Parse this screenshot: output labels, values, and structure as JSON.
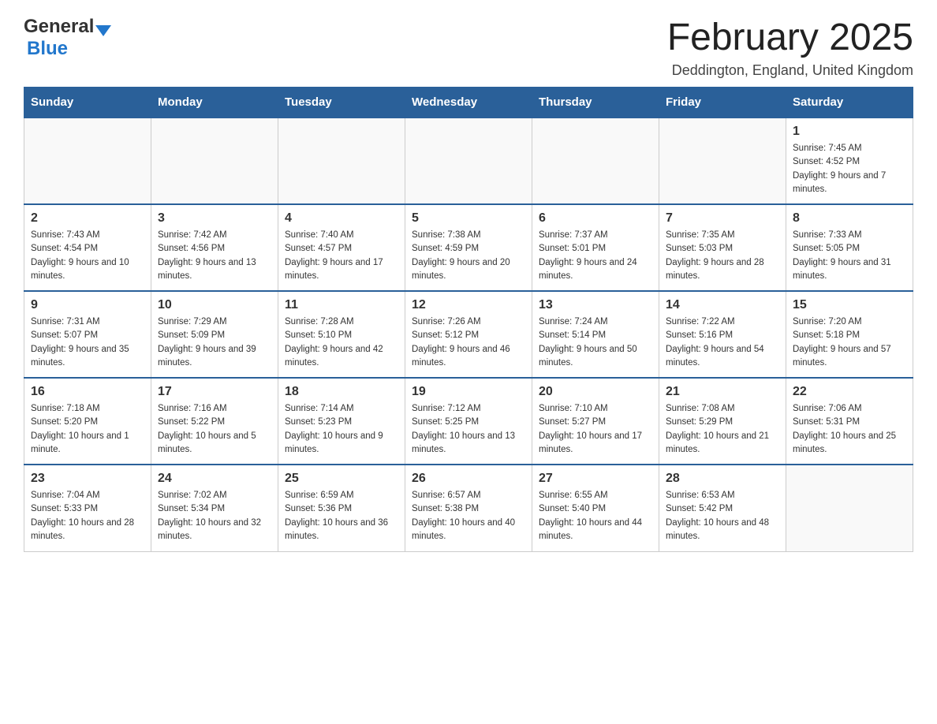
{
  "header": {
    "logo_general": "General",
    "logo_blue": "Blue",
    "month_title": "February 2025",
    "location": "Deddington, England, United Kingdom"
  },
  "days_of_week": [
    "Sunday",
    "Monday",
    "Tuesday",
    "Wednesday",
    "Thursday",
    "Friday",
    "Saturday"
  ],
  "weeks": [
    [
      {
        "day": "",
        "sunrise": "",
        "sunset": "",
        "daylight": ""
      },
      {
        "day": "",
        "sunrise": "",
        "sunset": "",
        "daylight": ""
      },
      {
        "day": "",
        "sunrise": "",
        "sunset": "",
        "daylight": ""
      },
      {
        "day": "",
        "sunrise": "",
        "sunset": "",
        "daylight": ""
      },
      {
        "day": "",
        "sunrise": "",
        "sunset": "",
        "daylight": ""
      },
      {
        "day": "",
        "sunrise": "",
        "sunset": "",
        "daylight": ""
      },
      {
        "day": "1",
        "sunrise": "Sunrise: 7:45 AM",
        "sunset": "Sunset: 4:52 PM",
        "daylight": "Daylight: 9 hours and 7 minutes."
      }
    ],
    [
      {
        "day": "2",
        "sunrise": "Sunrise: 7:43 AM",
        "sunset": "Sunset: 4:54 PM",
        "daylight": "Daylight: 9 hours and 10 minutes."
      },
      {
        "day": "3",
        "sunrise": "Sunrise: 7:42 AM",
        "sunset": "Sunset: 4:56 PM",
        "daylight": "Daylight: 9 hours and 13 minutes."
      },
      {
        "day": "4",
        "sunrise": "Sunrise: 7:40 AM",
        "sunset": "Sunset: 4:57 PM",
        "daylight": "Daylight: 9 hours and 17 minutes."
      },
      {
        "day": "5",
        "sunrise": "Sunrise: 7:38 AM",
        "sunset": "Sunset: 4:59 PM",
        "daylight": "Daylight: 9 hours and 20 minutes."
      },
      {
        "day": "6",
        "sunrise": "Sunrise: 7:37 AM",
        "sunset": "Sunset: 5:01 PM",
        "daylight": "Daylight: 9 hours and 24 minutes."
      },
      {
        "day": "7",
        "sunrise": "Sunrise: 7:35 AM",
        "sunset": "Sunset: 5:03 PM",
        "daylight": "Daylight: 9 hours and 28 minutes."
      },
      {
        "day": "8",
        "sunrise": "Sunrise: 7:33 AM",
        "sunset": "Sunset: 5:05 PM",
        "daylight": "Daylight: 9 hours and 31 minutes."
      }
    ],
    [
      {
        "day": "9",
        "sunrise": "Sunrise: 7:31 AM",
        "sunset": "Sunset: 5:07 PM",
        "daylight": "Daylight: 9 hours and 35 minutes."
      },
      {
        "day": "10",
        "sunrise": "Sunrise: 7:29 AM",
        "sunset": "Sunset: 5:09 PM",
        "daylight": "Daylight: 9 hours and 39 minutes."
      },
      {
        "day": "11",
        "sunrise": "Sunrise: 7:28 AM",
        "sunset": "Sunset: 5:10 PM",
        "daylight": "Daylight: 9 hours and 42 minutes."
      },
      {
        "day": "12",
        "sunrise": "Sunrise: 7:26 AM",
        "sunset": "Sunset: 5:12 PM",
        "daylight": "Daylight: 9 hours and 46 minutes."
      },
      {
        "day": "13",
        "sunrise": "Sunrise: 7:24 AM",
        "sunset": "Sunset: 5:14 PM",
        "daylight": "Daylight: 9 hours and 50 minutes."
      },
      {
        "day": "14",
        "sunrise": "Sunrise: 7:22 AM",
        "sunset": "Sunset: 5:16 PM",
        "daylight": "Daylight: 9 hours and 54 minutes."
      },
      {
        "day": "15",
        "sunrise": "Sunrise: 7:20 AM",
        "sunset": "Sunset: 5:18 PM",
        "daylight": "Daylight: 9 hours and 57 minutes."
      }
    ],
    [
      {
        "day": "16",
        "sunrise": "Sunrise: 7:18 AM",
        "sunset": "Sunset: 5:20 PM",
        "daylight": "Daylight: 10 hours and 1 minute."
      },
      {
        "day": "17",
        "sunrise": "Sunrise: 7:16 AM",
        "sunset": "Sunset: 5:22 PM",
        "daylight": "Daylight: 10 hours and 5 minutes."
      },
      {
        "day": "18",
        "sunrise": "Sunrise: 7:14 AM",
        "sunset": "Sunset: 5:23 PM",
        "daylight": "Daylight: 10 hours and 9 minutes."
      },
      {
        "day": "19",
        "sunrise": "Sunrise: 7:12 AM",
        "sunset": "Sunset: 5:25 PM",
        "daylight": "Daylight: 10 hours and 13 minutes."
      },
      {
        "day": "20",
        "sunrise": "Sunrise: 7:10 AM",
        "sunset": "Sunset: 5:27 PM",
        "daylight": "Daylight: 10 hours and 17 minutes."
      },
      {
        "day": "21",
        "sunrise": "Sunrise: 7:08 AM",
        "sunset": "Sunset: 5:29 PM",
        "daylight": "Daylight: 10 hours and 21 minutes."
      },
      {
        "day": "22",
        "sunrise": "Sunrise: 7:06 AM",
        "sunset": "Sunset: 5:31 PM",
        "daylight": "Daylight: 10 hours and 25 minutes."
      }
    ],
    [
      {
        "day": "23",
        "sunrise": "Sunrise: 7:04 AM",
        "sunset": "Sunset: 5:33 PM",
        "daylight": "Daylight: 10 hours and 28 minutes."
      },
      {
        "day": "24",
        "sunrise": "Sunrise: 7:02 AM",
        "sunset": "Sunset: 5:34 PM",
        "daylight": "Daylight: 10 hours and 32 minutes."
      },
      {
        "day": "25",
        "sunrise": "Sunrise: 6:59 AM",
        "sunset": "Sunset: 5:36 PM",
        "daylight": "Daylight: 10 hours and 36 minutes."
      },
      {
        "day": "26",
        "sunrise": "Sunrise: 6:57 AM",
        "sunset": "Sunset: 5:38 PM",
        "daylight": "Daylight: 10 hours and 40 minutes."
      },
      {
        "day": "27",
        "sunrise": "Sunrise: 6:55 AM",
        "sunset": "Sunset: 5:40 PM",
        "daylight": "Daylight: 10 hours and 44 minutes."
      },
      {
        "day": "28",
        "sunrise": "Sunrise: 6:53 AM",
        "sunset": "Sunset: 5:42 PM",
        "daylight": "Daylight: 10 hours and 48 minutes."
      },
      {
        "day": "",
        "sunrise": "",
        "sunset": "",
        "daylight": ""
      }
    ]
  ]
}
